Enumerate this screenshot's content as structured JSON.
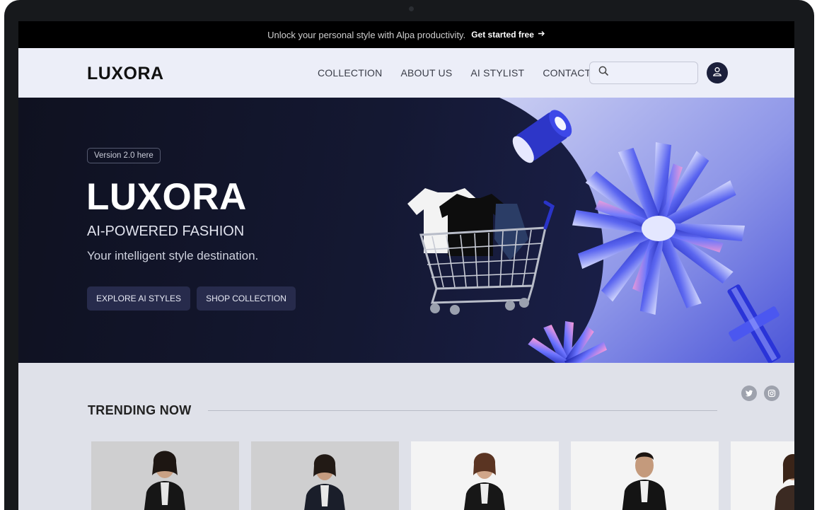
{
  "announcement": {
    "text": "Unlock your personal style with Alpa productivity.",
    "cta_label": "Get started free",
    "cta_icon": "arrow-right-icon"
  },
  "header": {
    "logo": "LUXORA",
    "nav": [
      "COLLECTION",
      "ABOUT US",
      "AI STYLIST",
      "CONTACT"
    ],
    "search": {
      "value": "",
      "placeholder": ""
    },
    "icons": {
      "search": "search-icon",
      "account": "user-icon"
    }
  },
  "hero": {
    "badge": "Version 2.0 here",
    "title": "LUXORA",
    "subtitle": "AI-POWERED FASHION",
    "tagline": "Your intelligent style destination.",
    "buttons": [
      "EXPLORE AI STYLES",
      "SHOP COLLECTION"
    ],
    "illustration": "shopping-cart-with-clothes"
  },
  "trending": {
    "title": "TRENDING NOW",
    "social_icons": [
      "twitter-icon",
      "instagram-icon"
    ],
    "products": [
      {
        "image": "woman-in-black-leather-jacket"
      },
      {
        "image": "woman-in-black-leather-jacket"
      },
      {
        "image": "woman-in-black-leather-jacket"
      },
      {
        "image": "man-in-black-leather-jacket"
      },
      {
        "image": "woman-in-brown-jacket"
      }
    ]
  },
  "colors": {
    "accent": "#3a46d6",
    "hero_dark": "#111426",
    "header_bg": "#eceef8",
    "announce_bg": "#000000",
    "button_bg": "#272b4c"
  }
}
